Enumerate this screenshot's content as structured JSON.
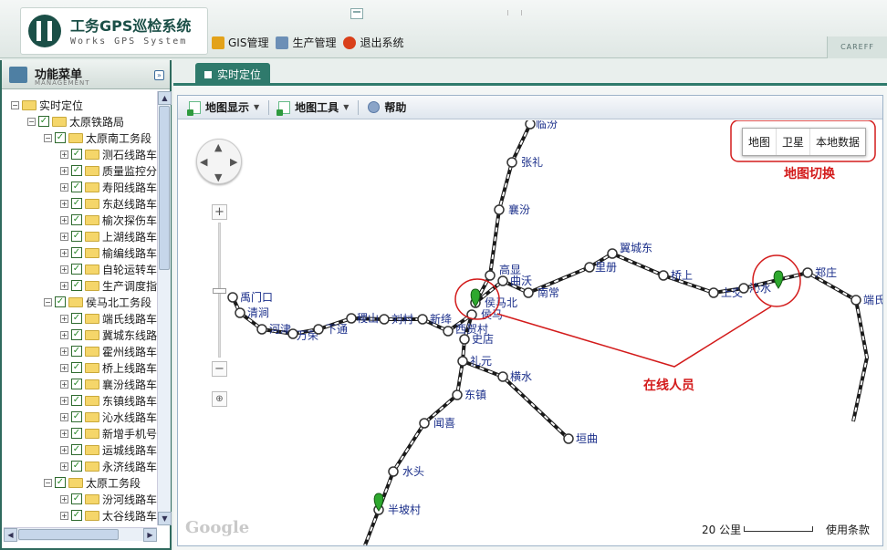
{
  "app": {
    "title": "工务GPS巡检系统",
    "subtitle": "Works GPS System",
    "corner_label": "CAREFF"
  },
  "top_nav": [
    {
      "label": "GIS管理",
      "icon": "gis-icon",
      "color": "#e3a21a"
    },
    {
      "label": "生产管理",
      "icon": "production-icon",
      "color": "#6c8fb6"
    },
    {
      "label": "退出系统",
      "icon": "exit-icon",
      "color": "#d9401a"
    }
  ],
  "sidebar": {
    "title": "功能菜单",
    "subtitle": "MANAGEMENT",
    "tree": [
      {
        "level": 0,
        "label": "实时定位",
        "expander": "−",
        "checkbox": false
      },
      {
        "level": 1,
        "label": "太原铁路局",
        "expander": "−",
        "checkbox": true
      },
      {
        "level": 2,
        "label": "太原南工务段",
        "expander": "−",
        "checkbox": true
      },
      {
        "level": 3,
        "label": "测石线路车间",
        "expander": "+",
        "checkbox": true
      },
      {
        "level": 3,
        "label": "质量监控分",
        "expander": "+",
        "checkbox": true
      },
      {
        "level": 3,
        "label": "寿阳线路车",
        "expander": "+",
        "checkbox": true
      },
      {
        "level": 3,
        "label": "东赵线路车",
        "expander": "+",
        "checkbox": true
      },
      {
        "level": 3,
        "label": "榆次探伤车",
        "expander": "+",
        "checkbox": true
      },
      {
        "level": 3,
        "label": "上湖线路车",
        "expander": "+",
        "checkbox": true
      },
      {
        "level": 3,
        "label": "榆编线路车",
        "expander": "+",
        "checkbox": true
      },
      {
        "level": 3,
        "label": "自轮运转车",
        "expander": "+",
        "checkbox": true
      },
      {
        "level": 3,
        "label": "生产调度指",
        "expander": "+",
        "checkbox": true
      },
      {
        "level": 2,
        "label": "侯马北工务段",
        "expander": "−",
        "checkbox": true
      },
      {
        "level": 3,
        "label": "端氏线路车",
        "expander": "+",
        "checkbox": true
      },
      {
        "level": 3,
        "label": "冀城东线路",
        "expander": "+",
        "checkbox": true
      },
      {
        "level": 3,
        "label": "霍州线路车",
        "expander": "+",
        "checkbox": true
      },
      {
        "level": 3,
        "label": "桥上线路车",
        "expander": "+",
        "checkbox": true
      },
      {
        "level": 3,
        "label": "襄汾线路车",
        "expander": "+",
        "checkbox": true
      },
      {
        "level": 3,
        "label": "东镇线路车",
        "expander": "+",
        "checkbox": true
      },
      {
        "level": 3,
        "label": "沁水线路车",
        "expander": "+",
        "checkbox": true
      },
      {
        "level": 3,
        "label": "新增手机号",
        "expander": "+",
        "checkbox": true
      },
      {
        "level": 3,
        "label": "运城线路车",
        "expander": "+",
        "checkbox": true
      },
      {
        "level": 3,
        "label": "永济线路车",
        "expander": "+",
        "checkbox": true
      },
      {
        "level": 2,
        "label": "太原工务段",
        "expander": "−",
        "checkbox": true
      },
      {
        "level": 3,
        "label": "汾河线路车",
        "expander": "+",
        "checkbox": true
      },
      {
        "level": 3,
        "label": "太谷线路车",
        "expander": "+",
        "checkbox": true
      }
    ]
  },
  "tabs": [
    {
      "label": "实时定位",
      "active": true
    }
  ],
  "toolbar": {
    "map_display": "地图显示",
    "map_tools": "地图工具",
    "help": "帮助"
  },
  "map": {
    "types": [
      "地图",
      "卫星",
      "本地数据"
    ],
    "callout_switch": "地图切换",
    "callout_online": "在线人员",
    "google_label": "Google",
    "scale": "20 公里",
    "terms": "使用条款",
    "cities": [
      {
        "name": "临汾"
      },
      {
        "name": "张礼"
      },
      {
        "name": "襄汾"
      },
      {
        "name": "高显"
      },
      {
        "name": "曲沃"
      },
      {
        "name": "侯马北"
      },
      {
        "name": "侯马"
      },
      {
        "name": "南常"
      },
      {
        "name": "里册"
      },
      {
        "name": "翼城东"
      },
      {
        "name": "桥上"
      },
      {
        "name": "上交"
      },
      {
        "name": "沁水"
      },
      {
        "name": "郑庄"
      },
      {
        "name": "端氏"
      },
      {
        "name": "禹门口"
      },
      {
        "name": "清涧"
      },
      {
        "name": "河津"
      },
      {
        "name": "万荣"
      },
      {
        "name": "下通"
      },
      {
        "name": "稷山"
      },
      {
        "name": "刘村"
      },
      {
        "name": "新绛"
      },
      {
        "name": "西贺村"
      },
      {
        "name": "史店"
      },
      {
        "name": "礼元"
      },
      {
        "name": "横水"
      },
      {
        "name": "东镇"
      },
      {
        "name": "垣曲"
      },
      {
        "name": "闻喜"
      },
      {
        "name": "水头"
      },
      {
        "name": "半坡村"
      }
    ]
  }
}
